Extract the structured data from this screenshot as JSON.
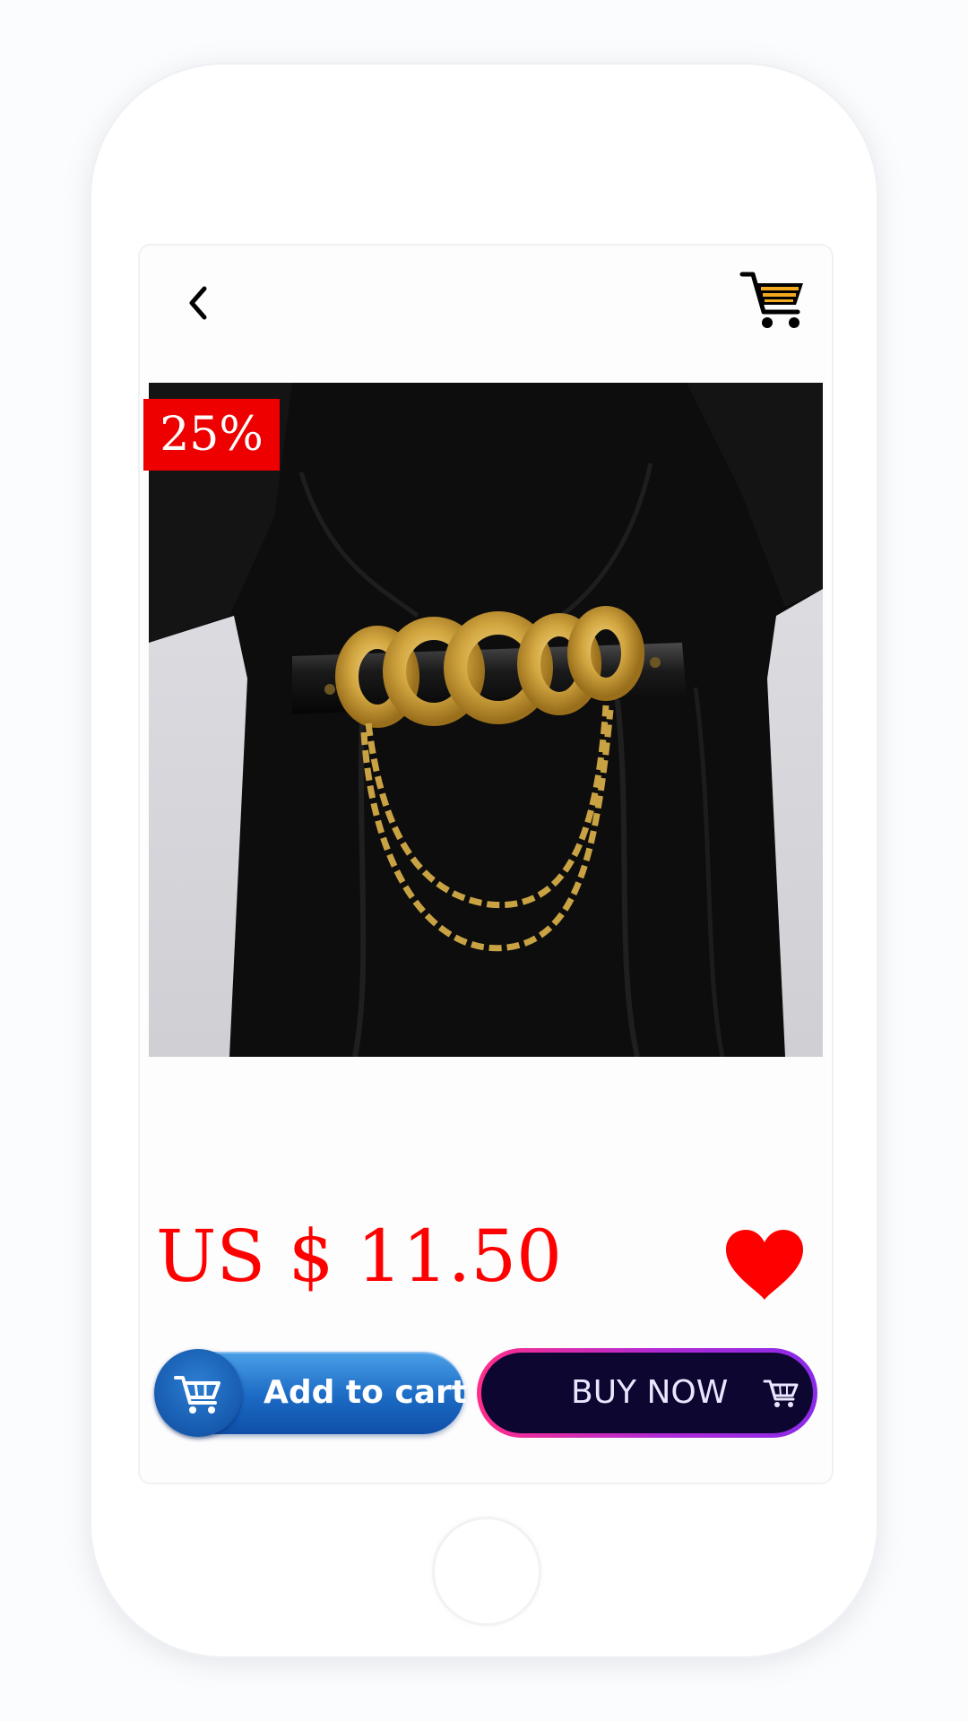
{
  "product": {
    "discount_badge": "25%",
    "price": "US $ 11.50",
    "image_icon": "product-photo-black-dress-gold-chain-belt"
  },
  "header": {
    "back_icon": "chevron-left-icon",
    "cart_icon": "shopping-cart-icon"
  },
  "actions": {
    "add_to_cart_label": "Add to cart",
    "buy_now_label": "BUY NOW",
    "wishlist_icon": "heart-icon"
  },
  "colors": {
    "price": "#ff0000",
    "badge": "#ee0000",
    "heart": "#ff0000",
    "add_to_cart": "#1b6ac4",
    "buy_now_bg": "#0c0630"
  }
}
